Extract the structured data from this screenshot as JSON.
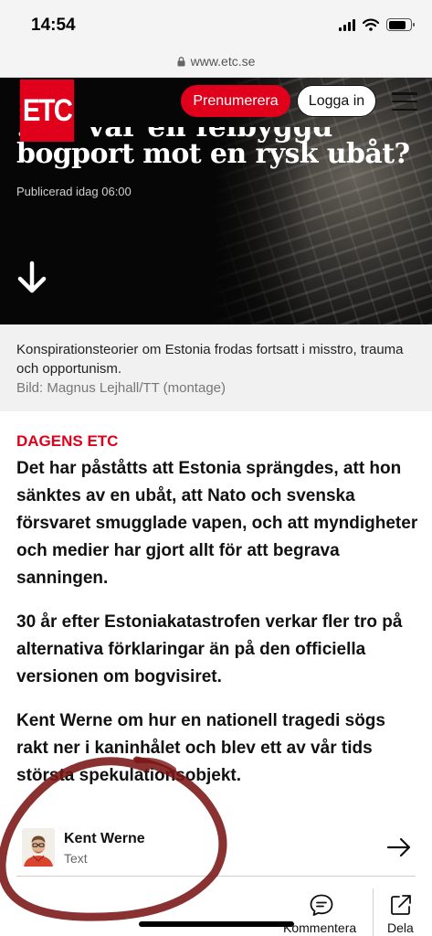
{
  "status_bar": {
    "time": "14:54",
    "battery_level": 0.8
  },
  "browser": {
    "url": "www.etc.se"
  },
  "header": {
    "logo_text": "ETC",
    "subscribe_label": "Prenumerera",
    "login_label": "Logga in"
  },
  "hero": {
    "title_partial": "…ar var en felbyggd",
    "title": "bogport mot en rysk ubåt?",
    "published": "Publicerad idag 06:00"
  },
  "image_caption": {
    "text": "Konspirationsteorier om Estonia frodas fortsatt i misstro, trauma och opportunism.",
    "credit": "Bild: Magnus Lejhall/TT (montage)"
  },
  "article": {
    "section_label": "DAGENS ETC",
    "paragraphs": [
      "Det har påståtts att Estonia sprängdes, att hon sänktes av en ubåt, att Nato och svenska försvaret smugglade vapen, och att myndigheter och medier har gjort allt för att begrava sanningen.",
      "30 år efter Estoniakatastrofen verkar fler tro på alternativa förklaringar än på den officiella versionen om bogvisiret.",
      "Kent Werne om hur en nationell tragedi sögs rakt ner i kaninhålet och blev ett av vår tids största spekulationsobjekt."
    ]
  },
  "author": {
    "name": "Kent Werne",
    "role": "Text"
  },
  "actions": {
    "comment_label": "Kommentera",
    "share_label": "Dela"
  },
  "colors": {
    "brand_red": "#e0001b",
    "scribble": "#7a1414"
  }
}
